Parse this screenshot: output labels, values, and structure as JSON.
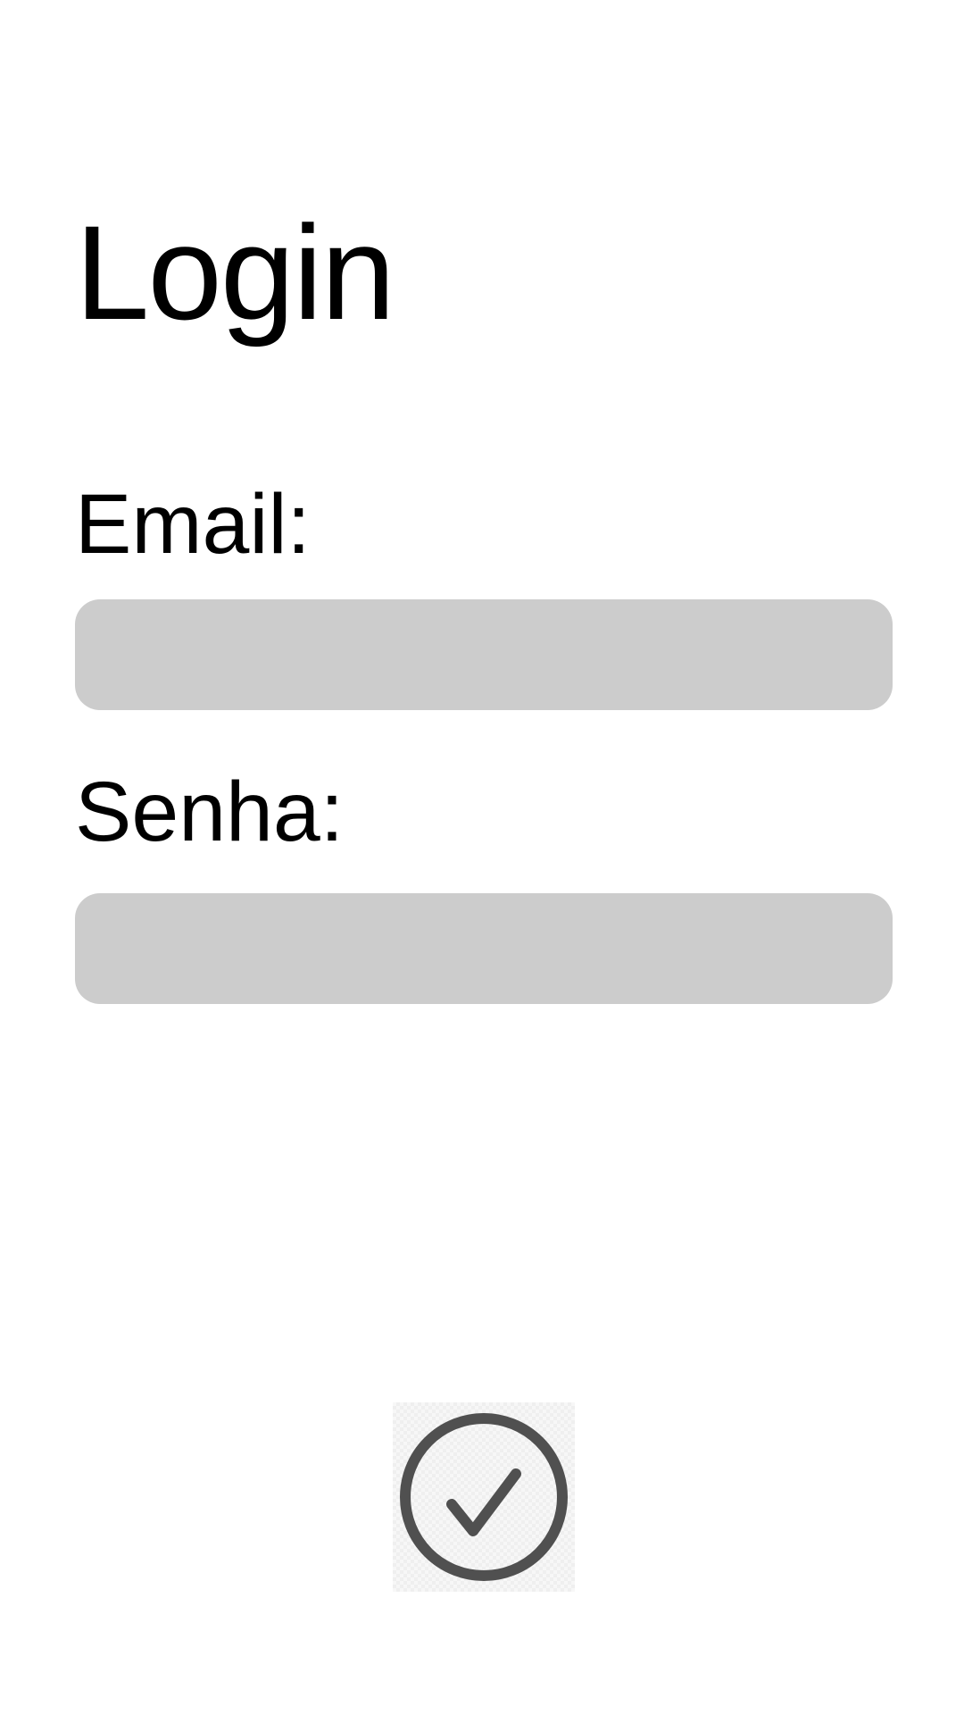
{
  "page": {
    "title": "Login"
  },
  "form": {
    "email": {
      "label": "Email:",
      "value": "",
      "placeholder": ""
    },
    "password": {
      "label": "Senha:",
      "value": "",
      "placeholder": ""
    }
  },
  "actions": {
    "confirm_icon": "check-circle-icon"
  },
  "colors": {
    "background": "#ffffff",
    "input_fill": "#cccccc",
    "icon": "#505050",
    "text": "#000000"
  }
}
